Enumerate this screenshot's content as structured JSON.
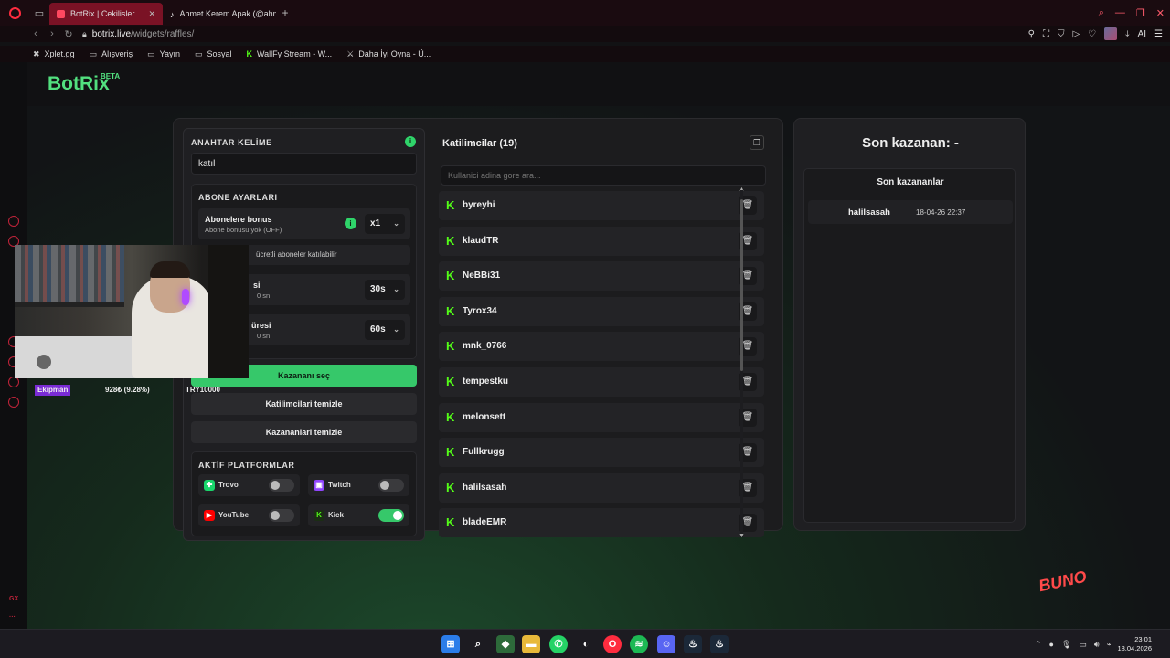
{
  "browser": {
    "tabs": [
      {
        "title": "BotRix | Cekilisler",
        "active": true
      },
      {
        "title": "Ahmet Kerem Apak (@ahm",
        "active": false
      }
    ],
    "url_host": "botrix.live",
    "url_path": "/widgets/raffles/",
    "bookmarks": [
      "Xplet.gg",
      "Alışveriş",
      "Yayın",
      "Sosyal",
      "WallFy Stream - W...",
      "Daha İyi Oyna - Ü..."
    ]
  },
  "brand": {
    "name": "BotRix",
    "badge": "BETA"
  },
  "settings": {
    "keyword_title": "ANAHTAR KELİME",
    "keyword_value": "katıl",
    "sub_title": "ABONE AYARLARI",
    "sub_bonus_title": "Abonelere bonus",
    "sub_bonus_sub": "Abone bonusu yok (OFF)",
    "sub_bonus_value": "x1",
    "free_subs_text": "ücretli aboneler katılabilir",
    "timer1_title": "si",
    "timer1_sub": "0 sn",
    "timer1_value": "30s",
    "timer2_title": "üresi",
    "timer2_sub": "0 sn",
    "timer2_value": "60s",
    "pick_winner": "Kazananı seç",
    "clear_participants": "Katilimcilari temizle",
    "clear_winners": "Kazananlari temizle",
    "platforms_title": "AKTİF PLATFORMLAR",
    "platforms": [
      {
        "name": "Trovo",
        "enabled": false,
        "color": "#19d66b"
      },
      {
        "name": "Twitch",
        "enabled": false,
        "color": "#9146ff"
      },
      {
        "name": "YouTube",
        "enabled": false,
        "color": "#ff0000"
      },
      {
        "name": "Kick",
        "enabled": true,
        "color": "#53fc18"
      }
    ]
  },
  "participants": {
    "title": "Katilimcilar (19)",
    "search_placeholder": "Kullanici adina gore ara...",
    "list": [
      "byreyhi",
      "klaudTR",
      "NeBBi31",
      "Tyrox34",
      "mnk_0766",
      "tempestku",
      "melonsett",
      "Fullkrugg",
      "halilsasah",
      "bladeEMR"
    ]
  },
  "winner": {
    "title": "Son kazanan: -",
    "recent_title": "Son kazananlar",
    "recent": [
      {
        "name": "halilsasah",
        "date": "18-04-26 22:37"
      }
    ]
  },
  "stream_overlay": {
    "tag": "Ekipman",
    "pct": "928₺ (9.28%)",
    "money": "TRY10000"
  },
  "taskbar": {
    "time": "23:01",
    "date": "18.04.2026"
  }
}
